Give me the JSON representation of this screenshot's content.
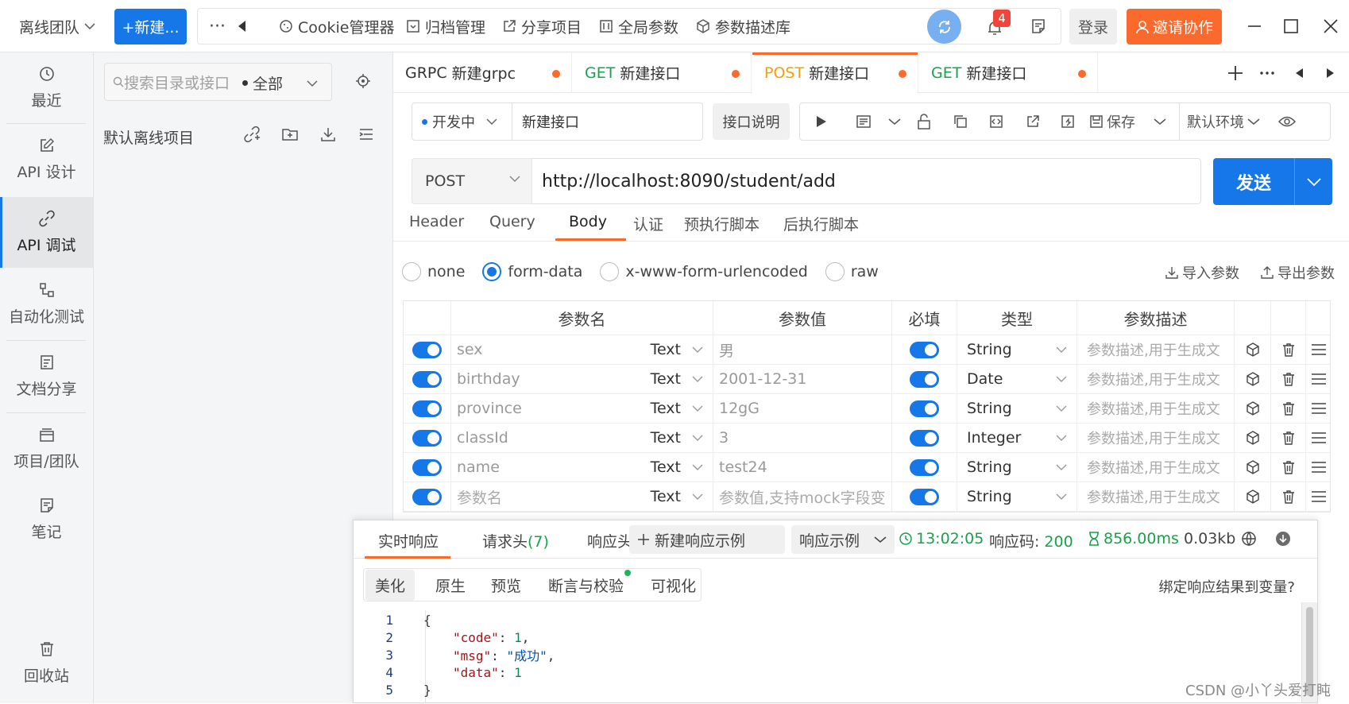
{
  "topbar": {
    "team": "离线团队",
    "new_btn": "+新建...",
    "more": "···",
    "tools": [
      "Cookie管理器",
      "归档管理",
      "分享项目",
      "全局参数",
      "参数描述库"
    ],
    "notif_count": "4",
    "login": "登录",
    "invite": "邀请协作"
  },
  "leftnav": [
    "最近",
    "API 设计",
    "API 调试",
    "自动化测试",
    "文档分享",
    "项目/团队",
    "笔记",
    "回收站"
  ],
  "projpanel": {
    "search_placeholder": "搜索目录或接口",
    "scope": "全部",
    "project_name": "默认离线项目"
  },
  "tabs": [
    {
      "method": "GRPC",
      "name": "新建grpc"
    },
    {
      "method": "GET",
      "name": "新建接口"
    },
    {
      "method": "POST",
      "name": "新建接口"
    },
    {
      "method": "GET",
      "name": "新建接口"
    }
  ],
  "colors": {
    "accent": "#1677e8",
    "orange": "#fb6a2d",
    "get": "#16a34a",
    "post": "#f59e0b"
  },
  "env": {
    "status": "开发中",
    "api_name": "新建接口",
    "api_desc_btn": "接口说明",
    "save": "保存",
    "env_name": "默认环境"
  },
  "request": {
    "method": "POST",
    "url": "http://localhost:8090/student/add",
    "send": "发送"
  },
  "req_tabs": [
    "Header",
    "Query",
    "Body",
    "认证",
    "预执行脚本",
    "后执行脚本"
  ],
  "body_types": [
    "none",
    "form-data",
    "x-www-form-urlencoded",
    "raw"
  ],
  "import_params": "导入参数",
  "export_params": "导出参数",
  "table": {
    "headers": [
      "参数名",
      "参数值",
      "必填",
      "类型",
      "参数描述"
    ],
    "rows": [
      {
        "name": "sex",
        "ftype": "Text",
        "value": "男",
        "type": "String",
        "desc": "参数描述,用于生成文"
      },
      {
        "name": "birthday",
        "ftype": "Text",
        "value": "2001-12-31",
        "type": "Date",
        "desc": "参数描述,用于生成文"
      },
      {
        "name": "province",
        "ftype": "Text",
        "value": "12gG",
        "type": "String",
        "desc": "参数描述,用于生成文"
      },
      {
        "name": "classId",
        "ftype": "Text",
        "value": "3",
        "type": "Integer",
        "desc": "参数描述,用于生成文"
      },
      {
        "name": "name",
        "ftype": "Text",
        "value": "test24",
        "type": "String",
        "desc": "参数描述,用于生成文"
      },
      {
        "name": "参数名",
        "ftype": "Text",
        "value": "参数值,支持mock字段变",
        "type": "String",
        "desc": "参数描述,用于生成文"
      }
    ]
  },
  "response": {
    "tab_live": "实时响应",
    "tab_headers": "请求头",
    "headers_count": "(7)",
    "tab_resp_headers": "响应头",
    "new_example": "新建响应示例",
    "example": "响应示例",
    "time": "13:02:05",
    "code_label": "响应码:",
    "code": "200",
    "duration": "856.00ms",
    "size": "0.03kb",
    "sub_tabs": [
      "美化",
      "原生",
      "预览",
      "断言与校验",
      "可视化"
    ],
    "bind": "绑定响应结果到变量?",
    "lines": [
      "1",
      "2",
      "3",
      "4",
      "5"
    ],
    "json": {
      "k_code": "\"code\"",
      "v_code": "1",
      "k_msg": "\"msg\"",
      "v_msg": "\"成功\"",
      "k_data": "\"data\"",
      "v_data": "1"
    }
  },
  "watermark": "CSDN @小丫头爱打盹"
}
